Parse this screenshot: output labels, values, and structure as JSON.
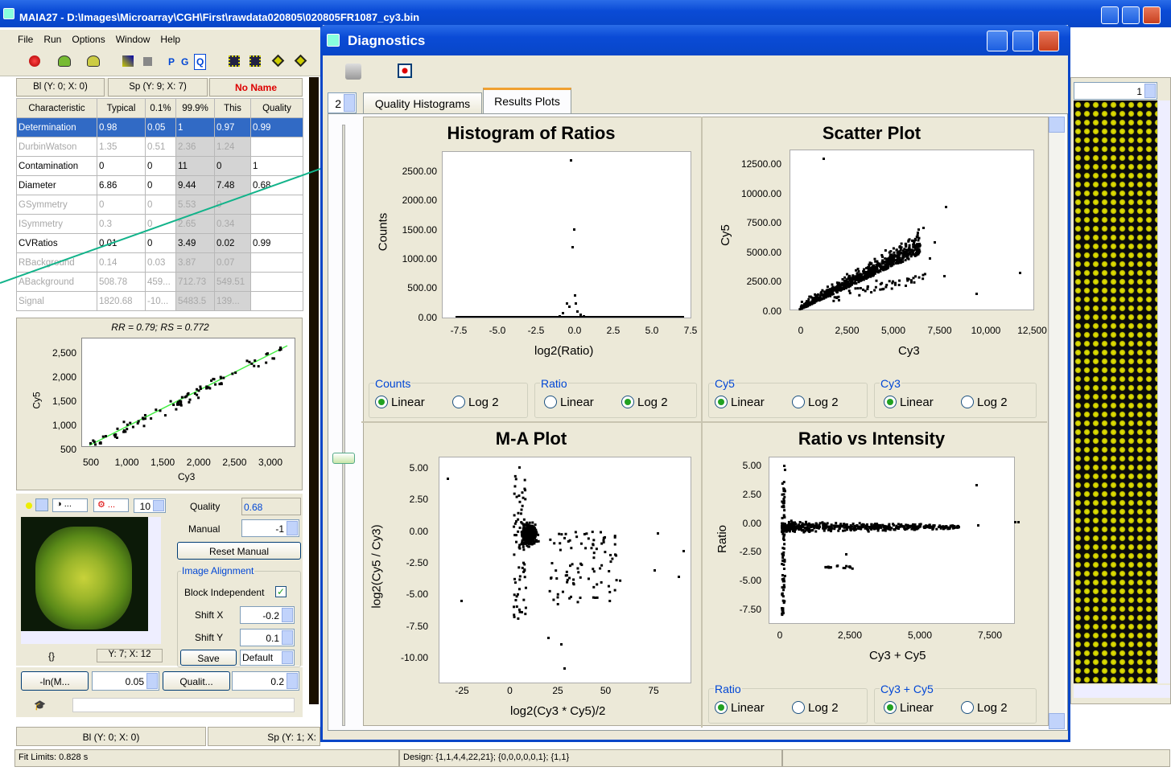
{
  "main": {
    "title": "MAIA27 - D:\\Images\\Microarray\\CGH\\First\\rawdata020805\\020805FR1087_cy3.bin",
    "menu": [
      "File",
      "Run",
      "Options",
      "Window",
      "Help"
    ],
    "toolbar_letters": [
      "P",
      "G",
      "Q"
    ],
    "bl_label": "Bl (Y: 0; X: 0)",
    "sp_label": "Sp (Y: 9; X: 7)",
    "name_label": "No Name",
    "right_spin": "1",
    "icons": {
      "app": "app-icon"
    }
  },
  "table": {
    "headers": [
      "Characteristic",
      "Typical",
      "0.1%",
      "99.9%",
      "This",
      "Quality"
    ],
    "rows": [
      {
        "c": [
          "Determination",
          "0.98",
          "0.05",
          "1",
          "0.97",
          "0.99"
        ],
        "state": "sel"
      },
      {
        "c": [
          "DurbinWatson",
          "1.35",
          "0.51",
          "2.36",
          "1.24",
          ""
        ],
        "state": "dim"
      },
      {
        "c": [
          "Contamination",
          "0",
          "0",
          "11",
          "0",
          "1"
        ],
        "state": "norm"
      },
      {
        "c": [
          "Diameter",
          "6.86",
          "0",
          "9.44",
          "7.48",
          "0.68"
        ],
        "state": "norm"
      },
      {
        "c": [
          "GSymmetry",
          "0",
          "0",
          "5.53",
          "0",
          ""
        ],
        "state": "dim"
      },
      {
        "c": [
          "ISymmetry",
          "0.3",
          "0",
          "2.65",
          "0.34",
          ""
        ],
        "state": "dim"
      },
      {
        "c": [
          "CVRatios",
          "0.01",
          "0",
          "3.49",
          "0.02",
          "0.99"
        ],
        "state": "norm"
      },
      {
        "c": [
          "RBackground",
          "0.14",
          "0.03",
          "3.87",
          "0.07",
          ""
        ],
        "state": "dim"
      },
      {
        "c": [
          "ABackground",
          "508.78",
          "459...",
          "712.73",
          "549.51",
          ""
        ],
        "state": "dim"
      },
      {
        "c": [
          "Signal",
          "1820.68",
          "-10...",
          "5483.5",
          "139...",
          ""
        ],
        "state": "dim"
      }
    ]
  },
  "small_plot": {
    "title": "RR = 0.79; RS = 0.772",
    "xlabel": "Cy3",
    "ylabel": "Cy5",
    "xticks": [
      "500",
      "1,000",
      "1,500",
      "2,000",
      "2,500",
      "3,000"
    ],
    "yticks": [
      "2,500",
      "2,000",
      "1,500",
      "1,000",
      "500"
    ]
  },
  "spot_panel": {
    "spot_count": "10",
    "quality_label": "Quality",
    "quality_value": "0.68",
    "manual_label": "Manual",
    "manual_value": "-1",
    "reset_label": "Reset Manual",
    "alignment_label": "Image Alignment",
    "block_label": "Block Independent",
    "shiftx_label": "Shift X",
    "shiftx_value": "-0.2",
    "shifty_label": "Shift Y",
    "shifty_value": "0.1",
    "save_label": "Save",
    "default_label": "Default",
    "brace": "{}",
    "coord": "Y: 7; X: 12"
  },
  "bottom_ctrls": {
    "ln_label": "-ln(M...",
    "ln_value": "0.05",
    "qual_label": "Qualit...",
    "qual_value": "0.2"
  },
  "status": {
    "bl2": "Bl (Y: 0; X: 0)",
    "sp2": "Sp (Y: 1; X:",
    "fit": "Fit Limits: 0.828 s",
    "design": "Design: {1,1,4,4,22,21}; {0,0,0,0,0,1}; {1,1}"
  },
  "diag": {
    "title": "Diagnostics",
    "spin_value": "2",
    "tabs": [
      "Quality Histograms",
      "Results Plots"
    ],
    "plots": {
      "hist": {
        "title": "Histogram of Ratios",
        "xlabel": "log2(Ratio)",
        "ylabel": "Counts",
        "xticks": [
          "-7.5",
          "-5.0",
          "-2.5",
          "0.0",
          "2.5",
          "5.0",
          "7.5"
        ],
        "yticks": [
          "2500.00",
          "2000.00",
          "1500.00",
          "1000.00",
          "500.00",
          "0.00"
        ]
      },
      "scatter": {
        "title": "Scatter Plot",
        "xlabel": "Cy3",
        "ylabel": "Cy5",
        "xticks": [
          "0",
          "2,500",
          "5,000",
          "7,500",
          "10,000",
          "12,500"
        ],
        "yticks": [
          "12500.00",
          "10000.00",
          "7500.00",
          "5000.00",
          "2500.00",
          "0.00"
        ]
      },
      "ma": {
        "title": "M-A Plot",
        "xlabel": "log2(Cy3 * Cy5)/2",
        "ylabel": "log2(Cy5 / Cy3)",
        "xticks": [
          "-25",
          "0",
          "25",
          "50",
          "75"
        ],
        "yticks": [
          "5.00",
          "2.50",
          "0.00",
          "-2.50",
          "-5.00",
          "-7.50",
          "-10.00"
        ]
      },
      "rvi": {
        "title": "Ratio vs Intensity",
        "xlabel": "Cy3 + Cy5",
        "ylabel": "Ratio",
        "xticks": [
          "0",
          "2,500",
          "5,000",
          "7,500"
        ],
        "yticks": [
          "5.00",
          "2.50",
          "0.00",
          "-2.50",
          "-5.00",
          "-7.50"
        ]
      }
    },
    "groups": {
      "counts": "Counts",
      "ratio": "Ratio",
      "cy5": "Cy5",
      "cy3": "Cy3",
      "ratio2": "Ratio",
      "cy3cy5": "Cy3 + Cy5",
      "linear": "Linear",
      "log2": "Log 2"
    }
  },
  "colors": {
    "titlebar": "#0a4bd6",
    "selection": "#316ac5",
    "arrow": "#12b38a",
    "fit_line": "#44ee44"
  }
}
